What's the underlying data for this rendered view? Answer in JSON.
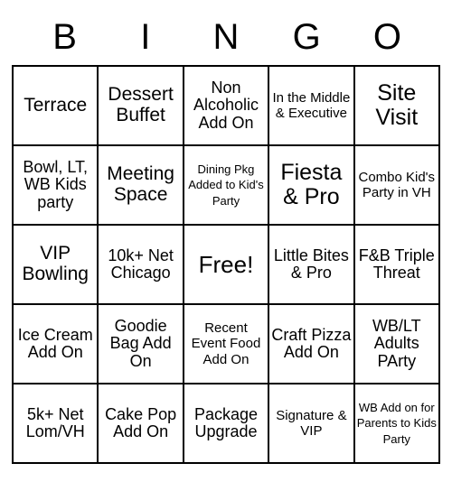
{
  "header": {
    "letters": [
      "B",
      "I",
      "N",
      "G",
      "O"
    ]
  },
  "grid": {
    "rows": [
      [
        {
          "text": "Terrace",
          "size": "sz-lg"
        },
        {
          "text": "Dessert Buffet",
          "size": "sz-lg"
        },
        {
          "text": "Non Alcoholic Add On",
          "size": "sz-md"
        },
        {
          "text": "In the Middle & Executive",
          "size": "sz-sm"
        },
        {
          "text": "Site Visit",
          "size": "sz-xl"
        }
      ],
      [
        {
          "text": "Bowl, LT, WB Kids party",
          "size": "sz-md"
        },
        {
          "text": "Meeting Space",
          "size": "sz-lg"
        },
        {
          "text": "Dining Pkg Added to Kid's Party",
          "size": "sz-xs"
        },
        {
          "text": "Fiesta & Pro",
          "size": "sz-xl"
        },
        {
          "text": "Combo Kid's Party in VH",
          "size": "sz-sm"
        }
      ],
      [
        {
          "text": "VIP Bowling",
          "size": "sz-lg"
        },
        {
          "text": "10k+ Net Chicago",
          "size": "sz-md"
        },
        {
          "text": "Free!",
          "size": "free"
        },
        {
          "text": "Little Bites & Pro",
          "size": "sz-md"
        },
        {
          "text": "F&B Triple Threat",
          "size": "sz-md"
        }
      ],
      [
        {
          "text": "Ice Cream Add On",
          "size": "sz-md"
        },
        {
          "text": "Goodie Bag Add On",
          "size": "sz-md"
        },
        {
          "text": "Recent Event Food Add On",
          "size": "sz-sm"
        },
        {
          "text": "Craft Pizza Add On",
          "size": "sz-md"
        },
        {
          "text": "WB/LT Adults PArty",
          "size": "sz-md"
        }
      ],
      [
        {
          "text": "5k+ Net Lom/VH",
          "size": "sz-md"
        },
        {
          "text": "Cake Pop Add On",
          "size": "sz-md"
        },
        {
          "text": "Package Upgrade",
          "size": "sz-md"
        },
        {
          "text": "Signature & VIP",
          "size": "sz-sm"
        },
        {
          "text": "WB Add on for Parents to Kids Party",
          "size": "sz-xs"
        }
      ]
    ]
  }
}
